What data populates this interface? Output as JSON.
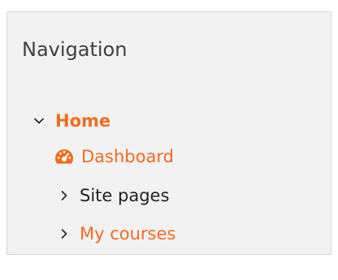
{
  "colors": {
    "accent": "#f46b1e",
    "text": "#1d2125",
    "title": "#404040",
    "block_bg": "#f2f2f2",
    "block_border": "#d4d4d4"
  },
  "navigation": {
    "title": "Navigation",
    "items": [
      {
        "label": "Home",
        "icon": "chevron-down-icon",
        "expanded": true,
        "current": true
      },
      {
        "label": "Dashboard",
        "icon": "dashboard-gauge-icon"
      },
      {
        "label": "Site pages",
        "icon": "chevron-right-icon",
        "expanded": false
      },
      {
        "label": "My courses",
        "icon": "chevron-right-icon",
        "expanded": false
      }
    ]
  }
}
